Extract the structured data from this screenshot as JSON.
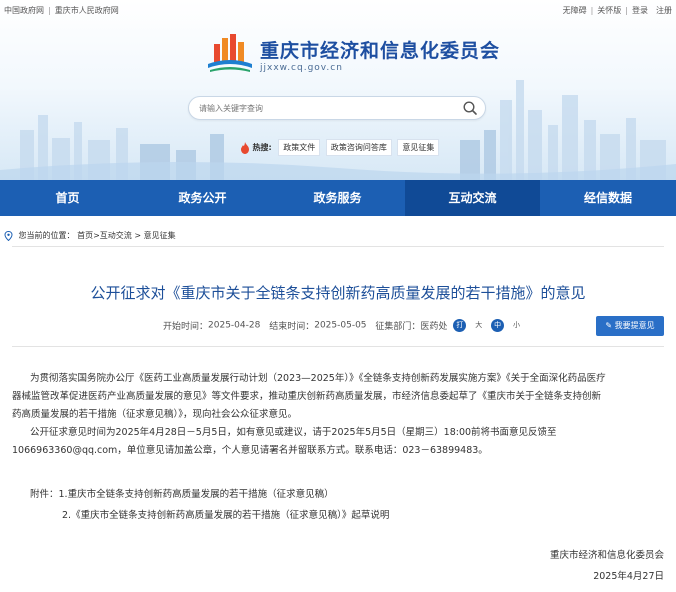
{
  "topbar": {
    "left_links": [
      "中国政府网",
      "重庆市人民政府网"
    ],
    "right_links": [
      "无障碍",
      "关怀版",
      "登录",
      "注册"
    ]
  },
  "site": {
    "title": "重庆市经济和信息化委员会",
    "domain": "jjxxw.cq.gov.cn"
  },
  "search": {
    "placeholder": "请输入关键字查询",
    "icon": "search-icon"
  },
  "hot": {
    "label": "热搜:",
    "tags": [
      "政策文件",
      "政策咨询问答库",
      "意见征集"
    ]
  },
  "nav": {
    "items": [
      "首页",
      "政务公开",
      "政务服务",
      "互动交流",
      "经信数据"
    ],
    "active": "互动交流"
  },
  "breadcrumb": {
    "prefix": "您当前的位置：",
    "path": "首页>互动交流 > 意见征集"
  },
  "article": {
    "title": "公开征求对《重庆市关于全链条支持创新药高质量发展的若干措施》的意见",
    "start_label": "开始时间：",
    "start_date": "2025-04-28",
    "end_label": "结束时间：",
    "end_date": "2025-05-05",
    "dept_label": "征集部门：",
    "dept": "医药处",
    "font_sizes": [
      "大",
      "中",
      "小"
    ],
    "font_large_label": "打",
    "feedback_button": "我要提意见",
    "paragraphs": [
      "为贯彻落实国务院办公厅《医药工业高质量发展行动计划（2023—2025年）》《全链条支持创新药发展实施方案》《关于全面深化药品医疗",
      "器械监管改革促进医药产业高质量发展的意见》等文件要求，推动重庆创新药高质量发展，市经济信息委起草了《重庆市关于全链条支持创新",
      "药高质量发展的若干措施（征求意见稿）》，现向社会公众征求意见。",
      "公开征求意见时间为2025年4月28日－5月5日，如有意见或建议，请于2025年5月5日（星期三）18:00前将书面意见反馈至",
      "1066963360@qq.com，单位意见请加盖公章，个人意见请署名并留联系方式。联系电话：023－63899483。"
    ],
    "attachments_label": "附件：",
    "attachments": [
      "1.重庆市全链条支持创新药高质量发展的若干措施（征求意见稿）",
      "2.《重庆市全链条支持创新药高质量发展的若干措施（征求意见稿）》起草说明"
    ],
    "signature_org": "重庆市经济和信息化委员会",
    "signature_date": "2025年4月27日"
  },
  "colors": {
    "nav": "#1c5fb3",
    "nav_active": "#104a96",
    "title": "#1d4f99",
    "button": "#2a6fc7"
  }
}
